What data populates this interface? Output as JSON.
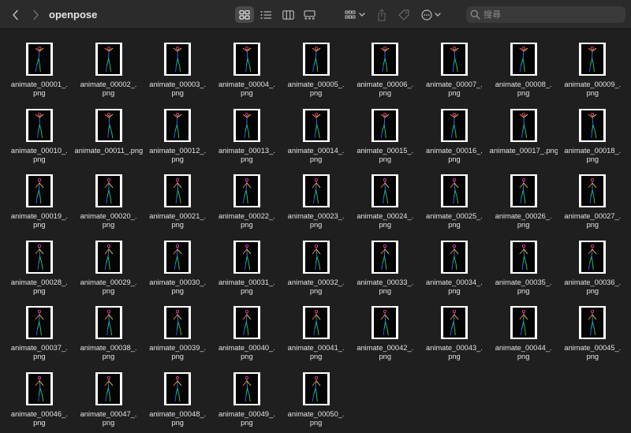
{
  "window": {
    "title": "openpose",
    "search_placeholder": "搜尋",
    "icons": {
      "back": "chevron-left-icon",
      "forward": "chevron-right-icon",
      "view_icon": "icon-grid-icon",
      "view_list": "list-icon",
      "view_column": "columns-icon",
      "view_gallery": "gallery-icon",
      "group": "group-by-icon",
      "share": "share-icon",
      "tag": "tag-icon",
      "more": "ellipsis-circle-icon",
      "search": "magnifier-icon"
    }
  },
  "files": [
    {
      "line1": "animate_00001_.",
      "line2": "png"
    },
    {
      "line1": "animate_00002_.",
      "line2": "png"
    },
    {
      "line1": "animate_00003_.",
      "line2": "png"
    },
    {
      "line1": "animate_00004_.",
      "line2": "png"
    },
    {
      "line1": "animate_00005_.",
      "line2": "png"
    },
    {
      "line1": "animate_00006_.",
      "line2": "png"
    },
    {
      "line1": "animate_00007_.",
      "line2": "png"
    },
    {
      "line1": "animate_00008_.",
      "line2": "png"
    },
    {
      "line1": "animate_00009_.",
      "line2": "png"
    },
    {
      "line1": "animate_00010_.",
      "line2": "png"
    },
    {
      "line1": "animate_00011_.png",
      "line2": ""
    },
    {
      "line1": "animate_00012_.",
      "line2": "png"
    },
    {
      "line1": "animate_00013_.",
      "line2": "png"
    },
    {
      "line1": "animate_00014_.",
      "line2": "png"
    },
    {
      "line1": "animate_00015_.",
      "line2": "png"
    },
    {
      "line1": "animate_00016_.",
      "line2": "png"
    },
    {
      "line1": "animate_00017_.png",
      "line2": ""
    },
    {
      "line1": "animate_00018_.",
      "line2": "png"
    },
    {
      "line1": "animate_00019_.",
      "line2": "png"
    },
    {
      "line1": "animate_00020_.",
      "line2": "png"
    },
    {
      "line1": "animate_00021_.",
      "line2": "png"
    },
    {
      "line1": "animate_00022_.",
      "line2": "png"
    },
    {
      "line1": "animate_00023_.",
      "line2": "png"
    },
    {
      "line1": "animate_00024_.",
      "line2": "png"
    },
    {
      "line1": "animate_00025_.",
      "line2": "png"
    },
    {
      "line1": "animate_00026_.",
      "line2": "png"
    },
    {
      "line1": "animate_00027_.",
      "line2": "png"
    },
    {
      "line1": "animate_00028_.",
      "line2": "png"
    },
    {
      "line1": "animate_00029_.",
      "line2": "png"
    },
    {
      "line1": "animate_00030_.",
      "line2": "png"
    },
    {
      "line1": "animate_00031_.",
      "line2": "png"
    },
    {
      "line1": "animate_00032_.",
      "line2": "png"
    },
    {
      "line1": "animate_00033_.",
      "line2": "png"
    },
    {
      "line1": "animate_00034_.",
      "line2": "png"
    },
    {
      "line1": "animate_00035_.",
      "line2": "png"
    },
    {
      "line1": "animate_00036_.",
      "line2": "png"
    },
    {
      "line1": "animate_00037_.",
      "line2": "png"
    },
    {
      "line1": "animate_00038_.",
      "line2": "png"
    },
    {
      "line1": "animate_00039_.",
      "line2": "png"
    },
    {
      "line1": "animate_00040_.",
      "line2": "png"
    },
    {
      "line1": "animate_00041_.",
      "line2": "png"
    },
    {
      "line1": "animate_00042_.",
      "line2": "png"
    },
    {
      "line1": "animate_00043_.",
      "line2": "png"
    },
    {
      "line1": "animate_00044_.",
      "line2": "png"
    },
    {
      "line1": "animate_00045_.",
      "line2": "png"
    },
    {
      "line1": "animate_00046_.",
      "line2": "png"
    },
    {
      "line1": "animate_00047_.",
      "line2": "png"
    },
    {
      "line1": "animate_00048_.",
      "line2": "png"
    },
    {
      "line1": "animate_00049_.",
      "line2": "png"
    },
    {
      "line1": "animate_00050_.",
      "line2": "png"
    }
  ],
  "colors": {
    "background": "#1f1f1f",
    "toolbar": "#2b2b2b",
    "text": "#e3e3e3",
    "thumbnail_frame": "#ffffff",
    "thumbnail_canvas": "#050505"
  }
}
